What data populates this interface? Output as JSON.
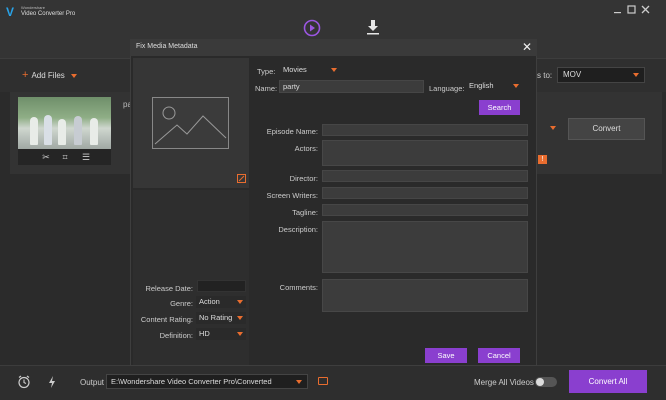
{
  "app": {
    "brand_small": "Wondershare",
    "brand_name": "Video Converter Pro"
  },
  "toolbar": {
    "add_files_label": "Add Files",
    "convert_to_label": "s to:",
    "convert_to_value": "MOV"
  },
  "file_row": {
    "title_fragment": "pa",
    "convert_label": "Convert"
  },
  "bottom": {
    "output_label": "Output",
    "output_path": "E:\\Wondershare Video Converter Pro\\Converted",
    "merge_label": "Merge All Videos",
    "convert_all_label": "Convert All"
  },
  "modal": {
    "title": "Fix Media Metadata",
    "type_label": "Type:",
    "type_value": "Movies",
    "name_label": "Name:",
    "name_value": "party",
    "language_label": "Language:",
    "language_value": "English",
    "search_label": "Search",
    "fields": {
      "episode_name": "Episode Name:",
      "actors": "Actors:",
      "director": "Director:",
      "screen_writers": "Screen Writers:",
      "tagline": "Tagline:",
      "description": "Description:",
      "comments": "Comments:"
    },
    "release_date_label": "Release Date:",
    "genre_label": "Genre:",
    "genre_value": "Action",
    "content_rating_label": "Content Rating:",
    "content_rating_value": "No Rating",
    "definition_label": "Definition:",
    "definition_value": "HD",
    "save_label": "Save",
    "cancel_label": "Cancel"
  },
  "colors": {
    "accent_orange": "#e96d2f",
    "accent_purple": "#8a3fcf",
    "logo_blue": "#29a3e8"
  },
  "icons": [
    "logo-icon",
    "convert-tab-icon",
    "download-tab-icon",
    "minimize-icon",
    "maximize-icon",
    "close-icon",
    "add-icon",
    "trim-icon",
    "crop-icon",
    "effects-icon",
    "info-icon",
    "schedule-icon",
    "speed-icon",
    "folder-icon",
    "image-placeholder-icon",
    "edit-icon"
  ]
}
